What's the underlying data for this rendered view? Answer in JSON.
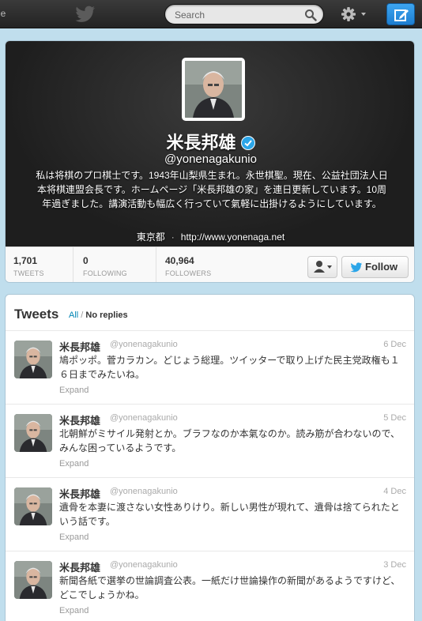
{
  "topbar": {
    "cut_text": "le",
    "search_placeholder": "Search",
    "icons": [
      "twitter-bird-icon",
      "search-icon",
      "gear-icon",
      "compose-icon"
    ]
  },
  "profile": {
    "name": "米長邦雄",
    "handle": "@yonenagakunio",
    "bio": "私は将棋のプロ棋士です。1943年山梨県生まれ。永世棋聖。現在、公益社団法人日本将棋連盟会長です。ホームページ「米長邦雄の家」を連日更新しています。10周年過ぎました。講演活動も幅広く行っていて氣軽に出掛けるようにしています。",
    "location": "東京都",
    "separator": "·",
    "url": "http://www.yonenaga.net",
    "stats": [
      {
        "value": "1,701",
        "label": "TWEETS"
      },
      {
        "value": "0",
        "label": "FOLLOWING"
      },
      {
        "value": "40,964",
        "label": "FOLLOWERS"
      }
    ],
    "follow_label": "Follow"
  },
  "timeline": {
    "title": "Tweets",
    "filter_all": "All",
    "filter_sep": "/",
    "filter_noreplies": "No replies",
    "tweets": [
      {
        "name": "米長邦雄",
        "handle": "@yonenagakunio",
        "date": "6 Dec",
        "text": "鳩ポッポ。菅カラカン。どじょう総理。ツイッターで取り上げた民主党政権も１６日までみたいね。",
        "expand": "Expand"
      },
      {
        "name": "米長邦雄",
        "handle": "@yonenagakunio",
        "date": "5 Dec",
        "text": "北朝鮮がミサイル発射とか。ブラフなのか本氣なのか。読み筋が合わないので、みんな困っているようです。",
        "expand": "Expand"
      },
      {
        "name": "米長邦雄",
        "handle": "@yonenagakunio",
        "date": "4 Dec",
        "text": "遺骨を本妻に渡さない女性ありけり。新しい男性が現れて、遺骨は捨てられたという話です。",
        "expand": "Expand"
      },
      {
        "name": "米長邦雄",
        "handle": "@yonenagakunio",
        "date": "3 Dec",
        "text": "新聞各紙で選挙の世論調査公表。一紙だけ世論操作の新聞があるようですけど、どこでしょうかね。",
        "expand": "Expand"
      }
    ]
  },
  "colors": {
    "link": "#0084b4",
    "page_bg": "#c0deed",
    "topbar": "#2b2b2b",
    "compose": "#2b8fe0",
    "verified": "#2ba5e8"
  }
}
